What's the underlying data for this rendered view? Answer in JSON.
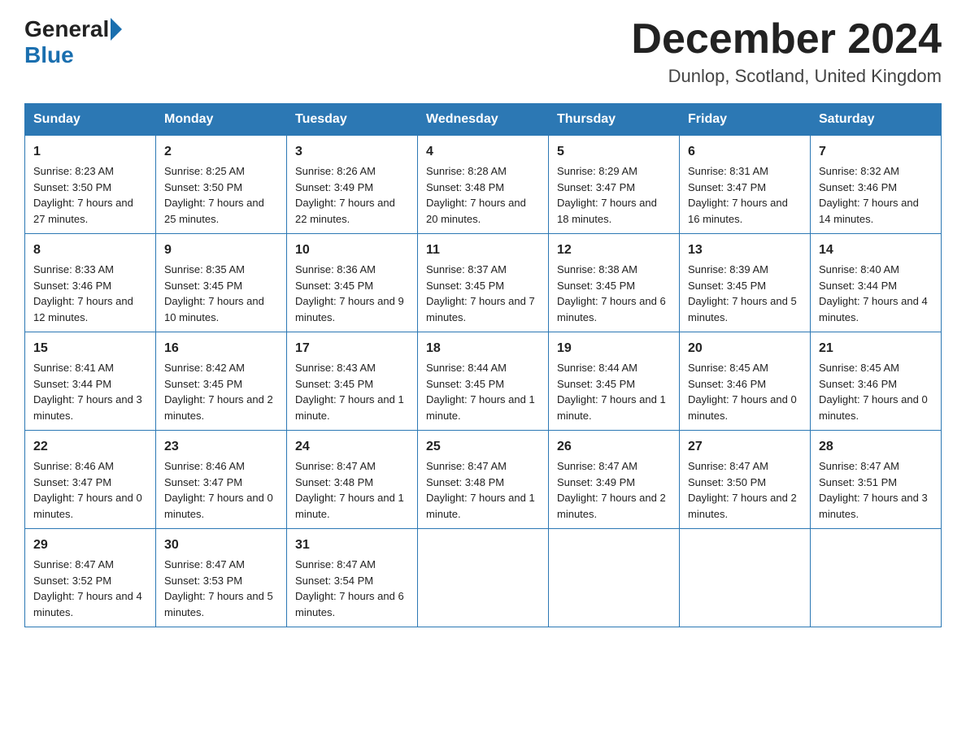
{
  "header": {
    "logo_general": "General",
    "logo_blue": "Blue",
    "month_title": "December 2024",
    "location": "Dunlop, Scotland, United Kingdom"
  },
  "columns": [
    "Sunday",
    "Monday",
    "Tuesday",
    "Wednesday",
    "Thursday",
    "Friday",
    "Saturday"
  ],
  "weeks": [
    [
      {
        "day": "1",
        "sunrise": "8:23 AM",
        "sunset": "3:50 PM",
        "daylight": "7 hours and 27 minutes."
      },
      {
        "day": "2",
        "sunrise": "8:25 AM",
        "sunset": "3:50 PM",
        "daylight": "7 hours and 25 minutes."
      },
      {
        "day": "3",
        "sunrise": "8:26 AM",
        "sunset": "3:49 PM",
        "daylight": "7 hours and 22 minutes."
      },
      {
        "day": "4",
        "sunrise": "8:28 AM",
        "sunset": "3:48 PM",
        "daylight": "7 hours and 20 minutes."
      },
      {
        "day": "5",
        "sunrise": "8:29 AM",
        "sunset": "3:47 PM",
        "daylight": "7 hours and 18 minutes."
      },
      {
        "day": "6",
        "sunrise": "8:31 AM",
        "sunset": "3:47 PM",
        "daylight": "7 hours and 16 minutes."
      },
      {
        "day": "7",
        "sunrise": "8:32 AM",
        "sunset": "3:46 PM",
        "daylight": "7 hours and 14 minutes."
      }
    ],
    [
      {
        "day": "8",
        "sunrise": "8:33 AM",
        "sunset": "3:46 PM",
        "daylight": "7 hours and 12 minutes."
      },
      {
        "day": "9",
        "sunrise": "8:35 AM",
        "sunset": "3:45 PM",
        "daylight": "7 hours and 10 minutes."
      },
      {
        "day": "10",
        "sunrise": "8:36 AM",
        "sunset": "3:45 PM",
        "daylight": "7 hours and 9 minutes."
      },
      {
        "day": "11",
        "sunrise": "8:37 AM",
        "sunset": "3:45 PM",
        "daylight": "7 hours and 7 minutes."
      },
      {
        "day": "12",
        "sunrise": "8:38 AM",
        "sunset": "3:45 PM",
        "daylight": "7 hours and 6 minutes."
      },
      {
        "day": "13",
        "sunrise": "8:39 AM",
        "sunset": "3:45 PM",
        "daylight": "7 hours and 5 minutes."
      },
      {
        "day": "14",
        "sunrise": "8:40 AM",
        "sunset": "3:44 PM",
        "daylight": "7 hours and 4 minutes."
      }
    ],
    [
      {
        "day": "15",
        "sunrise": "8:41 AM",
        "sunset": "3:44 PM",
        "daylight": "7 hours and 3 minutes."
      },
      {
        "day": "16",
        "sunrise": "8:42 AM",
        "sunset": "3:45 PM",
        "daylight": "7 hours and 2 minutes."
      },
      {
        "day": "17",
        "sunrise": "8:43 AM",
        "sunset": "3:45 PM",
        "daylight": "7 hours and 1 minute."
      },
      {
        "day": "18",
        "sunrise": "8:44 AM",
        "sunset": "3:45 PM",
        "daylight": "7 hours and 1 minute."
      },
      {
        "day": "19",
        "sunrise": "8:44 AM",
        "sunset": "3:45 PM",
        "daylight": "7 hours and 1 minute."
      },
      {
        "day": "20",
        "sunrise": "8:45 AM",
        "sunset": "3:46 PM",
        "daylight": "7 hours and 0 minutes."
      },
      {
        "day": "21",
        "sunrise": "8:45 AM",
        "sunset": "3:46 PM",
        "daylight": "7 hours and 0 minutes."
      }
    ],
    [
      {
        "day": "22",
        "sunrise": "8:46 AM",
        "sunset": "3:47 PM",
        "daylight": "7 hours and 0 minutes."
      },
      {
        "day": "23",
        "sunrise": "8:46 AM",
        "sunset": "3:47 PM",
        "daylight": "7 hours and 0 minutes."
      },
      {
        "day": "24",
        "sunrise": "8:47 AM",
        "sunset": "3:48 PM",
        "daylight": "7 hours and 1 minute."
      },
      {
        "day": "25",
        "sunrise": "8:47 AM",
        "sunset": "3:48 PM",
        "daylight": "7 hours and 1 minute."
      },
      {
        "day": "26",
        "sunrise": "8:47 AM",
        "sunset": "3:49 PM",
        "daylight": "7 hours and 2 minutes."
      },
      {
        "day": "27",
        "sunrise": "8:47 AM",
        "sunset": "3:50 PM",
        "daylight": "7 hours and 2 minutes."
      },
      {
        "day": "28",
        "sunrise": "8:47 AM",
        "sunset": "3:51 PM",
        "daylight": "7 hours and 3 minutes."
      }
    ],
    [
      {
        "day": "29",
        "sunrise": "8:47 AM",
        "sunset": "3:52 PM",
        "daylight": "7 hours and 4 minutes."
      },
      {
        "day": "30",
        "sunrise": "8:47 AM",
        "sunset": "3:53 PM",
        "daylight": "7 hours and 5 minutes."
      },
      {
        "day": "31",
        "sunrise": "8:47 AM",
        "sunset": "3:54 PM",
        "daylight": "7 hours and 6 minutes."
      },
      null,
      null,
      null,
      null
    ]
  ]
}
